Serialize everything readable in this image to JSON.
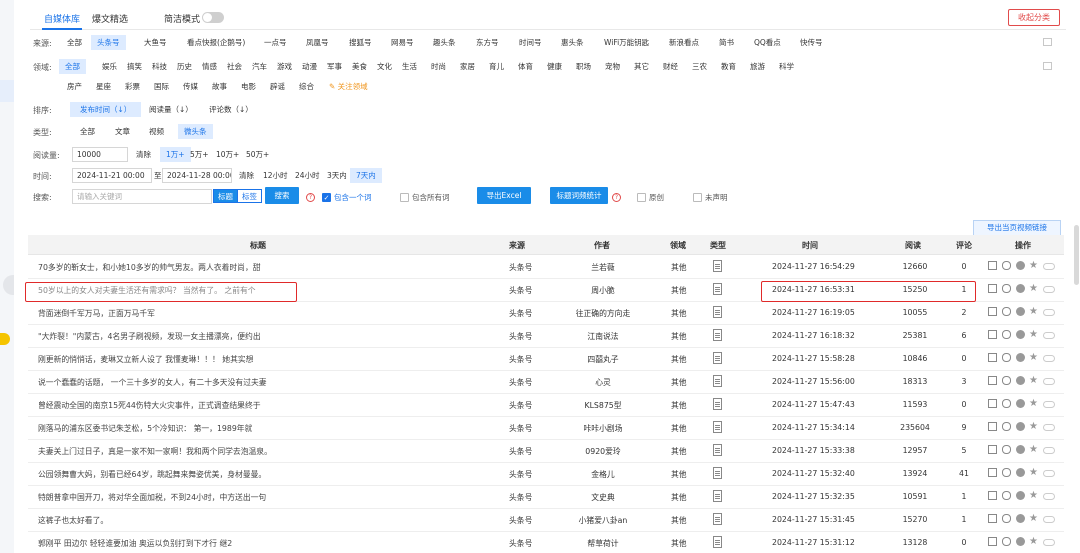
{
  "topbar": {
    "tabs": [
      "自媒体库",
      "爆文精选"
    ],
    "simple_mode_label": "简洁模式",
    "collapse_label": "收起分类"
  },
  "filters": {
    "source": {
      "label": "来源:",
      "options": [
        "全部",
        "头条号",
        "大鱼号",
        "看点快报(企鹅号)",
        "一点号",
        "凤凰号",
        "搜狐号",
        "网易号",
        "趣头条",
        "东方号",
        "时间号",
        "惠头条",
        "WiFi万能钥匙",
        "新浪看点",
        "简书",
        "QQ看点",
        "快传号"
      ],
      "selected": "头条号"
    },
    "domain": {
      "label": "领域:",
      "options_row1": [
        "全部",
        "娱乐",
        "搞笑",
        "科技",
        "历史",
        "情感",
        "社会",
        "汽车",
        "游戏",
        "动漫",
        "军事",
        "美食",
        "文化",
        "生活",
        "时尚",
        "家居",
        "育儿",
        "体育",
        "健康",
        "职场",
        "宠物",
        "其它",
        "财经",
        "三农",
        "教育",
        "旅游",
        "科学"
      ],
      "options_row2": [
        "房产",
        "星座",
        "彩票",
        "国际",
        "传媒",
        "故事",
        "电影",
        "辟谣",
        "综合"
      ],
      "follow_label": "关注领域",
      "selected": "全部"
    },
    "sort": {
      "label": "排序:",
      "options": [
        "发布时间（↓）",
        "阅读量（↓）",
        "评论数（↓）"
      ],
      "selected": "发布时间（↓）"
    },
    "type": {
      "label": "类型:",
      "options": [
        "全部",
        "文章",
        "视频",
        "微头条"
      ],
      "selected": "微头条"
    },
    "reads": {
      "label": "阅读量:",
      "value": "10000",
      "clear": "清除",
      "options": [
        "1万+",
        "5万+",
        "10万+",
        "50万+"
      ],
      "selected": "1万+"
    },
    "time": {
      "label": "时间:",
      "start": "2024-11-21 00:00",
      "separator": "至",
      "end": "2024-11-28 00:00",
      "clear": "清除",
      "options": [
        "12小时",
        "24小时",
        "3天内",
        "7天内"
      ],
      "selected": "7天内"
    },
    "search": {
      "label": "搜索:",
      "placeholder": "请输入关键词",
      "field_toggle": [
        "标题",
        "标签"
      ],
      "search_button": "搜索",
      "contains_one": "包含一个词",
      "contains_all": "包含所有词",
      "export_excel": "导出Excel",
      "title_stats": "标题词频统计",
      "original": "原创",
      "first_publish": "未声明"
    }
  },
  "export_video_label": "导出当页视频链接",
  "table": {
    "headers": [
      "标题",
      "来源",
      "作者",
      "领域",
      "类型",
      "时间",
      "阅读",
      "评论",
      "操作"
    ],
    "rows": [
      {
        "title": "70多岁的靳女士，和小她10多岁的帅气男友。两人衣着时尚，甜",
        "source": "头条号",
        "author": "兰若薇",
        "domain": "其他",
        "time": "2024-11-27 16:54:29",
        "reads": "12660",
        "comments": "0"
      },
      {
        "title": "50岁以上的女人对夫妻生活还有需求吗？ 当然有了。 之前有个",
        "source": "头条号",
        "author": "周小脆",
        "domain": "其他",
        "time": "2024-11-27 16:53:31",
        "reads": "15250",
        "comments": "1"
      },
      {
        "title": "背面迷倒千军万马，正面万马千军",
        "source": "头条号",
        "author": "往正确的方向走",
        "domain": "其他",
        "time": "2024-11-27 16:19:05",
        "reads": "10055",
        "comments": "2"
      },
      {
        "title": "\"大炸裂！\"内蒙古，4名男子刷视频，发现一女主播漂亮，便约出",
        "source": "头条号",
        "author": "江南说法",
        "domain": "其他",
        "time": "2024-11-27 16:18:32",
        "reads": "25381",
        "comments": "6"
      },
      {
        "title": "刚更新的悄悄话，麦琳又立新人设了 我懂麦琳！！！ 她其实想",
        "source": "头条号",
        "author": "四囍丸子",
        "domain": "其他",
        "time": "2024-11-27 15:58:28",
        "reads": "10846",
        "comments": "0"
      },
      {
        "title": "说一个蠢蠢的话题， 一个三十多岁的女人，有二十多天没有过夫妻",
        "source": "头条号",
        "author": "心灵",
        "domain": "其他",
        "time": "2024-11-27 15:56:00",
        "reads": "18313",
        "comments": "3"
      },
      {
        "title": "曾经震动全国的南京15死44伤特大火灾事件，正式调查结果终于",
        "source": "头条号",
        "author": "KLS875型",
        "domain": "其他",
        "time": "2024-11-27 15:47:43",
        "reads": "11593",
        "comments": "0"
      },
      {
        "title": "刚落马的浦东区委书记朱芝松，5个冷知识： 第一，1989年就",
        "source": "头条号",
        "author": "咔咔小剧场",
        "domain": "其他",
        "time": "2024-11-27 15:34:14",
        "reads": "235604",
        "comments": "9"
      },
      {
        "title": "夫妻关上门过日子，真是一家不知一家啊！我和两个同学去泡温泉。",
        "source": "头条号",
        "author": "0920爱玲",
        "domain": "其他",
        "time": "2024-11-27 15:33:38",
        "reads": "12957",
        "comments": "5"
      },
      {
        "title": "公园领舞曹大妈，别看已经64岁，跳起舞来舞姿优美，身材曼曼。",
        "source": "头条号",
        "author": "金格儿",
        "domain": "其他",
        "time": "2024-11-27 15:32:40",
        "reads": "13924",
        "comments": "41"
      },
      {
        "title": "特朗普拿中国开刀，将对华全面加税，不到24小时，中方送出一句",
        "source": "头条号",
        "author": "文史典",
        "domain": "其他",
        "time": "2024-11-27 15:32:35",
        "reads": "10591",
        "comments": "1"
      },
      {
        "title": "这裤子也太好看了。",
        "source": "头条号",
        "author": "小猪爱八卦an",
        "domain": "其他",
        "time": "2024-11-27 15:31:45",
        "reads": "15270",
        "comments": "1"
      },
      {
        "title": "郭刚平 田边尔 轻轻谁要加油 奥运以负别打到下才行 继2",
        "source": "头条号",
        "author": "帮草荷计",
        "domain": "其他",
        "time": "2024-11-27 15:31:12",
        "reads": "13128",
        "comments": "0"
      }
    ]
  },
  "colors": {
    "accent": "#1a73e8",
    "highlight": "#e02a2a",
    "selected_bg": "#ddebff"
  }
}
